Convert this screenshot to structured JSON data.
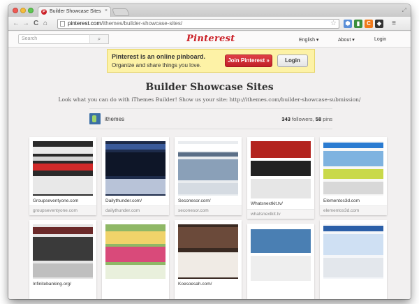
{
  "browser": {
    "tab_title": "Builder Showcase Sites",
    "tab_close": "×",
    "url_host": "pinterest.com",
    "url_path": "/ithemes/builder-showcase-sites/",
    "nav_back": "←",
    "nav_forward": "→",
    "nav_reload": "C",
    "nav_home": "⌂",
    "resize_glyph": "⤢"
  },
  "header": {
    "search_placeholder": "Search",
    "search_glyph": "⌕",
    "logo": "Pinterest",
    "nav": {
      "language": "English ▾",
      "about": "About ▾",
      "login": "Login"
    }
  },
  "banner": {
    "title": "Pinterest is an online pinboard.",
    "subtitle": "Organize and share things you love.",
    "join_label": "Join Pinterest »",
    "login_label": "Login"
  },
  "board": {
    "title": "Builder Showcase Sites",
    "description": "Look what you can do with iThemes Builder! Show us your site: http://ithemes.com/builder-showcase-submission/",
    "owner": "ithemes",
    "followers": "343",
    "followers_label": "followers,",
    "pins": "58",
    "pins_label": "pins"
  },
  "pins": [
    {
      "caption": "Groupseventyone.com",
      "source": "groupseventyone.com",
      "theme": "dark"
    },
    {
      "caption": "Dailythunder.com/",
      "source": "dailythunder.com",
      "theme": "navy"
    },
    {
      "caption": "Seconesor.com/",
      "source": "seconesor.com",
      "theme": "slate"
    },
    {
      "caption": "Whatsnextkit.tv/",
      "source": "whatsnextkit.tv",
      "theme": "red"
    },
    {
      "caption": "Elementos3d.com",
      "source": "elementos3d.com",
      "theme": "light"
    },
    {
      "caption": "Infinitebanking.org/",
      "source": "",
      "theme": "gray"
    },
    {
      "caption": "",
      "source": "",
      "theme": "green"
    },
    {
      "caption": "Koesoesah.com/",
      "source": "",
      "theme": "brown"
    },
    {
      "caption": "",
      "source": "",
      "theme": "teal"
    },
    {
      "caption": "",
      "source": "",
      "theme": "blue"
    }
  ],
  "colors": {
    "brand_red": "#cb2027",
    "banner_yellow": "#fdf2a6",
    "page_bg": "#f2f0f0"
  },
  "icons": {
    "extensions": [
      "star-icon",
      "puzzle-icon",
      "bookmark-icon",
      "shield-icon",
      "menu-icon"
    ]
  }
}
